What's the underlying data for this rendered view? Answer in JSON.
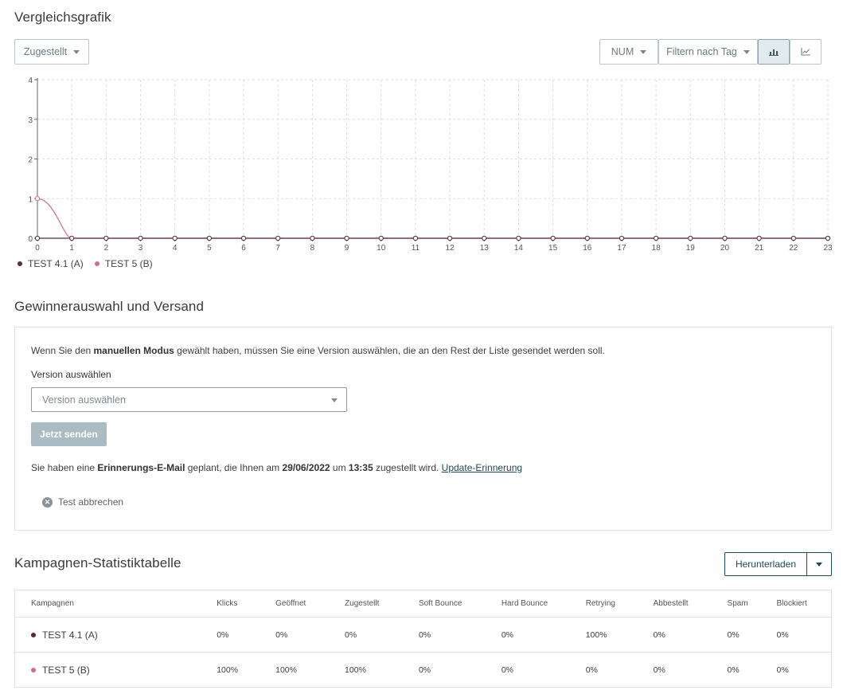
{
  "chart_section": {
    "title": "Vergleichsgrafik",
    "metric_dropdown": "Zugestellt",
    "num_dropdown": "NUM",
    "filter_dropdown": "Filtern nach Tag",
    "view_bar_icon": "bar-chart-icon",
    "view_line_icon": "line-chart-icon"
  },
  "chart_data": {
    "type": "line",
    "x": [
      0,
      1,
      2,
      3,
      4,
      5,
      6,
      7,
      8,
      9,
      10,
      11,
      12,
      13,
      14,
      15,
      16,
      17,
      18,
      19,
      20,
      21,
      22,
      23
    ],
    "ylim": [
      0,
      4
    ],
    "yticks": [
      0,
      1,
      2,
      3,
      4
    ],
    "grid": true,
    "legend_position": "bottom-left",
    "series": [
      {
        "name": "TEST 4.1 (A)",
        "color": "#5a2a3e",
        "values": [
          0,
          0,
          0,
          0,
          0,
          0,
          0,
          0,
          0,
          0,
          0,
          0,
          0,
          0,
          0,
          0,
          0,
          0,
          0,
          0,
          0,
          0,
          0,
          0
        ]
      },
      {
        "name": "TEST 5 (B)",
        "color": "#d06d8c",
        "values": [
          1,
          0,
          0,
          0,
          0,
          0,
          0,
          0,
          0,
          0,
          0,
          0,
          0,
          0,
          0,
          0,
          0,
          0,
          0,
          0,
          0,
          0,
          0,
          0
        ]
      }
    ]
  },
  "winner_section": {
    "title": "Gewinnerauswahl und Versand",
    "intro_before": "Wenn Sie den ",
    "intro_bold": "manuellen Modus",
    "intro_after": " gewählt haben, müssen Sie eine Version auswählen, die an den Rest der Liste gesendet werden soll.",
    "version_label": "Version auswählen",
    "version_placeholder": "Version auswählen",
    "send_button": "Jetzt senden",
    "reminder_1": "Sie haben eine ",
    "reminder_bold1": "Erinnerungs-E-Mail",
    "reminder_2": " geplant, die Ihnen am ",
    "reminder_date": "29/06/2022",
    "reminder_3": " um ",
    "reminder_time": "13:35",
    "reminder_4": " zugestellt wird. ",
    "reminder_link": "Update-Erinnerung",
    "cancel_label": "Test abbrechen"
  },
  "stats_section": {
    "title": "Kampagnen-Statistiktabelle",
    "download_button": "Herunterladen",
    "columns": [
      "Kampagnen",
      "Klicks",
      "Geöffnet",
      "Zugestellt",
      "Soft Bounce",
      "Hard Bounce",
      "Retrying",
      "Abbestellt",
      "Spam",
      "Blockiert"
    ],
    "rows": [
      {
        "name": "TEST 4.1 (A)",
        "color": "#5a2a3e",
        "values": [
          "0%",
          "0%",
          "0%",
          "0%",
          "0%",
          "100%",
          "0%",
          "0%",
          "0%"
        ]
      },
      {
        "name": "TEST 5 (B)",
        "color": "#d06d8c",
        "values": [
          "100%",
          "100%",
          "100%",
          "0%",
          "0%",
          "0%",
          "0%",
          "0%",
          "0%"
        ]
      }
    ]
  }
}
